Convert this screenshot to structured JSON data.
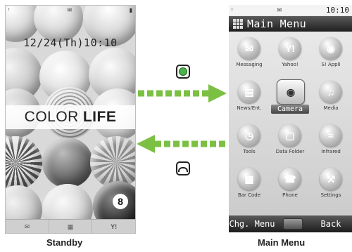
{
  "standby": {
    "clock": "12/24(Th)10:10",
    "banner_left": "COLOR",
    "banner_right": "LIFE",
    "caption": "Standby"
  },
  "main_menu": {
    "status_time": "10:10",
    "title": "Main Menu",
    "items": [
      {
        "label": "Messaging"
      },
      {
        "label": "Yahoo!"
      },
      {
        "label": "S! Appli"
      },
      {
        "label": "News/Ent."
      },
      {
        "label": "Camera"
      },
      {
        "label": "Media"
      },
      {
        "label": "Tools"
      },
      {
        "label": "Data Folder"
      },
      {
        "label": "Infrared"
      },
      {
        "label": "Bar Code"
      },
      {
        "label": "Phone"
      },
      {
        "label": "Settings"
      }
    ],
    "soft_left": "Chg. Menu",
    "soft_right": "Back",
    "caption": "Main Menu"
  },
  "colors": {
    "arrow": "#7bc043",
    "center_key": "#4cb34c",
    "titlebar": "#2a2a2a"
  }
}
